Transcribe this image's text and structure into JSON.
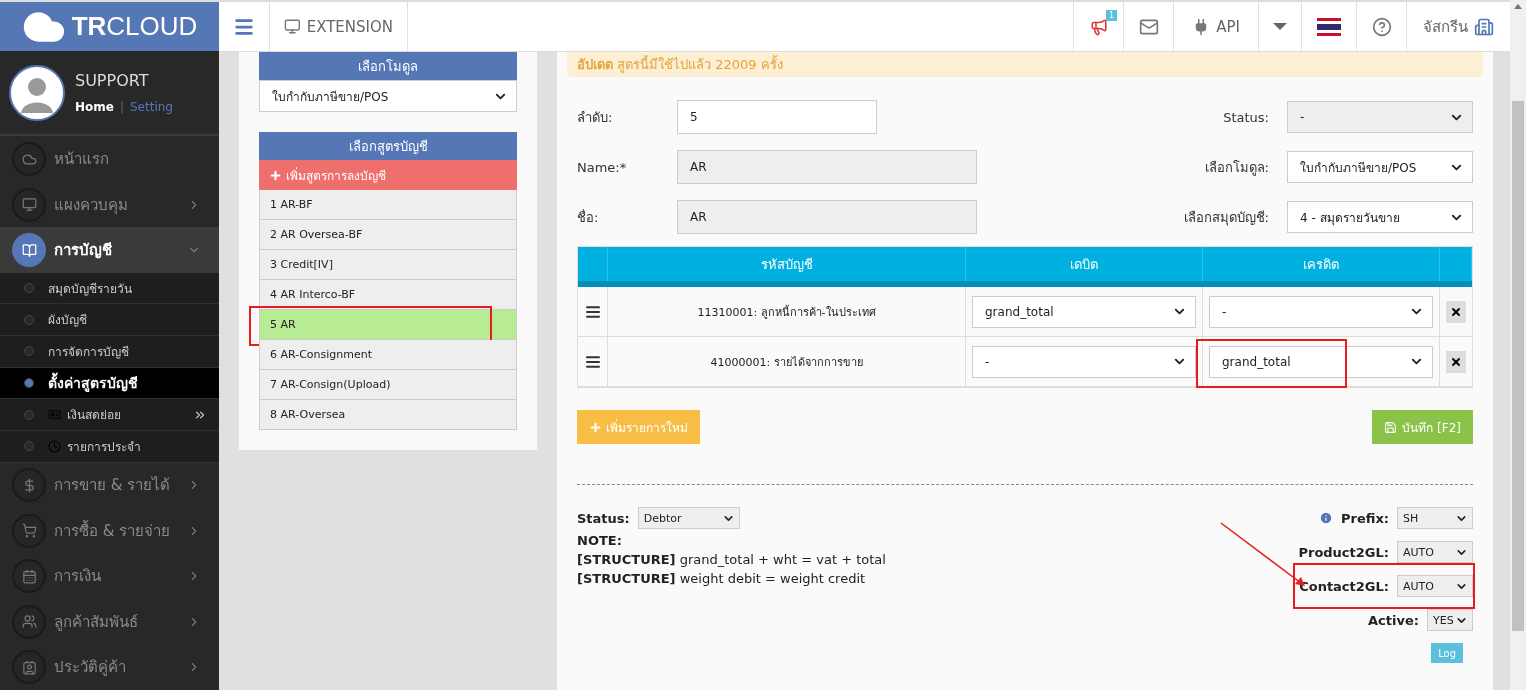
{
  "brand": {
    "bold": "TR",
    "rest": "CLOUD"
  },
  "header": {
    "extension": "EXTENSION",
    "notification_count": "1",
    "api": "API",
    "company": "จัสกรีน"
  },
  "profile": {
    "name": "SUPPORT",
    "separator": "|",
    "links": [
      {
        "label": "Home",
        "selected": true
      },
      {
        "label": "Setting",
        "selected": false
      }
    ]
  },
  "sidebar": {
    "items": [
      {
        "label": "หน้าแรก",
        "kind": "link",
        "selected": false
      },
      {
        "label": "แผงควบคุม",
        "kind": "menu",
        "selected": false,
        "expanded": false
      },
      {
        "label": "การบัญชี",
        "kind": "menu",
        "selected": true,
        "expanded": true,
        "children": [
          {
            "label": "สมุดบัญชีรายวัน",
            "kind": "link",
            "selected": false
          },
          {
            "label": "ผังบัญชี",
            "kind": "link",
            "selected": false
          },
          {
            "label": "การจัดการบัญชี",
            "kind": "link",
            "selected": false
          },
          {
            "label": "ตั้งค่าสูตรบัญชี",
            "kind": "link",
            "selected": true
          },
          {
            "label": "เงินสดย่อย",
            "kind": "submenu",
            "selected": false
          },
          {
            "label": "รายการประจำ",
            "kind": "link",
            "selected": false
          }
        ]
      },
      {
        "label": "การขาย & รายได้",
        "kind": "menu",
        "selected": false,
        "expanded": false
      },
      {
        "label": "การซื้อ & รายจ่าย",
        "kind": "menu",
        "selected": false,
        "expanded": false
      },
      {
        "label": "การเงิน",
        "kind": "menu",
        "selected": false,
        "expanded": false
      },
      {
        "label": "ลูกค้าสัมพันธ์",
        "kind": "menu",
        "selected": false,
        "expanded": false
      },
      {
        "label": "ประวัติคู่ค้า",
        "kind": "menu",
        "selected": false,
        "expanded": false
      }
    ]
  },
  "module_picker": {
    "title": "เลือกโมดูล",
    "value": "ใบกำกับภาษีขาย/POS"
  },
  "formula_list": {
    "title": "เลือกสูตรบัญชี",
    "add_button": "เพิ่มสูตรการลงบัญชี",
    "items": [
      {
        "label": "1 AR-BF",
        "selected": false,
        "highlighted": false
      },
      {
        "label": "2 AR Oversea-BF",
        "selected": false,
        "highlighted": false
      },
      {
        "label": "3 Credit[IV]",
        "selected": false,
        "highlighted": false
      },
      {
        "label": "4 AR Interco-BF",
        "selected": false,
        "highlighted": false
      },
      {
        "label": "5 AR",
        "selected": true,
        "highlighted": true
      },
      {
        "label": "6 AR-Consignment",
        "selected": false,
        "highlighted": false
      },
      {
        "label": "7 AR-Consign(Upload)",
        "selected": false,
        "highlighted": false
      },
      {
        "label": "8 AR-Oversea",
        "selected": false,
        "highlighted": false
      }
    ]
  },
  "form": {
    "banner": "**อัปเดต** สูตรนี้มีใช้ไปแล้ว 22009 ครั้ง",
    "left_fields": [
      {
        "label": "ลำดับ:",
        "value": "5",
        "disabled": false
      },
      {
        "label": "Name:*",
        "value": "AR",
        "disabled": true
      },
      {
        "label": "ชื่อ:",
        "value": "AR",
        "disabled": true
      }
    ],
    "right_fields": [
      {
        "label": "Status:",
        "value": "-",
        "disabled": true
      },
      {
        "label": "เลือกโมดูล:",
        "value": "ใบกำกับภาษีขาย/POS",
        "disabled": false
      },
      {
        "label": "เลือกสมุดบัญชี:",
        "value": "4 - สมุดรายวันขาย",
        "disabled": false
      }
    ]
  },
  "table": {
    "columns": [
      "รหัสบัญชี",
      "เดบิต",
      "เครดิต"
    ],
    "rows": [
      {
        "account": "11310001: ลูกหนี้การค้า-ในประเทศ",
        "debit": "grand_total",
        "credit": "-",
        "credit_highlighted": false
      },
      {
        "account": "41000001: รายได้จากการขาย",
        "debit": "-",
        "credit": "grand_total",
        "credit_highlighted": true
      }
    ]
  },
  "buttons": {
    "add": "เพิ่มรายการใหม่",
    "save": "บันทึก [F2]"
  },
  "bottom": {
    "status_label": "Status:",
    "status_value": "Debtor",
    "note_title": "NOTE:",
    "notes": [
      "**[STRUCTURE]** grand_total + wht = vat + total",
      "**[STRUCTURE]** weight debit = weight credit"
    ],
    "settings": [
      {
        "label": "Prefix:",
        "value": "SH",
        "info": true,
        "highlighted": false
      },
      {
        "label": "Product2GL:",
        "value": "AUTO",
        "info": false,
        "highlighted": false
      },
      {
        "label": "Contact2GL:",
        "value": "AUTO",
        "info": false,
        "highlighted": true
      },
      {
        "label": "Active:",
        "value": "YES",
        "info": false,
        "highlighted": false
      }
    ],
    "log_button": "Log"
  }
}
